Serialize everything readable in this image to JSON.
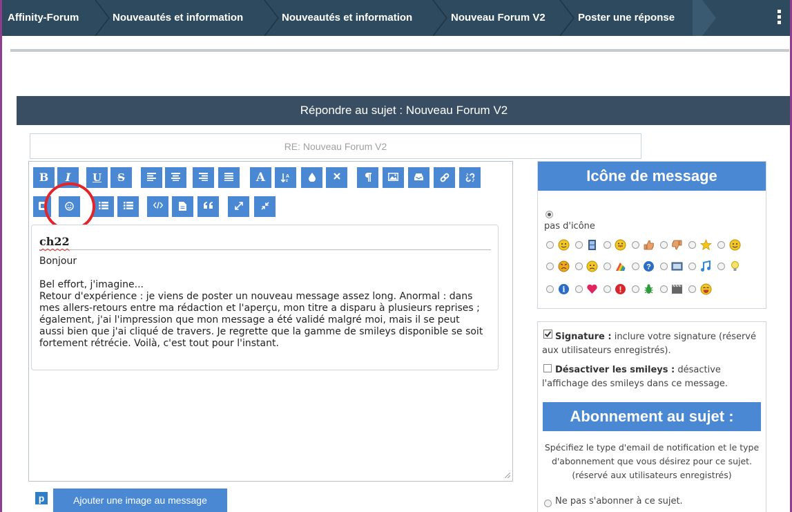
{
  "breadcrumb": {
    "items": [
      "Affinity-Forum",
      "Nouveautés et information",
      "Nouveautés et information",
      "Nouveau Forum V2",
      "Poster une réponse"
    ]
  },
  "form": {
    "heading": "Répondre au sujet : Nouveau Forum V2",
    "title_value": "RE: Nouveau Forum V2"
  },
  "toolbar": {
    "row1": [
      {
        "name": "bold-button",
        "icon": "B"
      },
      {
        "name": "italic-button",
        "icon": "I"
      },
      {
        "name": "underline-button",
        "icon": "U"
      },
      {
        "name": "strikethrough-button",
        "icon": "S"
      },
      {
        "name": "align-left-button",
        "icon": "align-left-icon"
      },
      {
        "name": "align-center-button",
        "icon": "align-center-icon"
      },
      {
        "name": "align-right-button",
        "icon": "align-right-icon"
      },
      {
        "name": "justify-button",
        "icon": "justify-icon"
      },
      {
        "name": "font-button",
        "icon": "A"
      },
      {
        "name": "font-size-button",
        "icon": "font-size-icon"
      },
      {
        "name": "color-button",
        "icon": "droplet-icon"
      },
      {
        "name": "remove-format-button",
        "icon": "close-icon"
      },
      {
        "name": "paragraph-button",
        "icon": "pilcrow-icon"
      },
      {
        "name": "image-button",
        "icon": "image-icon"
      },
      {
        "name": "hosted-image-button",
        "icon": "inbox-icon"
      },
      {
        "name": "link-button",
        "icon": "link-icon"
      },
      {
        "name": "unlink-button",
        "icon": "unlink-icon"
      }
    ],
    "row2": [
      {
        "name": "embed-button",
        "icon": "media-icon"
      },
      {
        "name": "emoticon-button",
        "icon": "smiley-icon"
      },
      {
        "name": "bullet-list-button",
        "icon": "list-icon"
      },
      {
        "name": "numbered-list-button",
        "icon": "list-ordered-icon"
      },
      {
        "name": "code-button",
        "icon": "code-icon"
      },
      {
        "name": "document-button",
        "icon": "document-icon"
      },
      {
        "name": "quote-button",
        "icon": "quote-icon"
      },
      {
        "name": "expand-button",
        "icon": "expand-icon"
      },
      {
        "name": "collapse-button",
        "icon": "collapse-icon"
      }
    ]
  },
  "message": {
    "signature_name": "ch22",
    "lines": [
      "Bonjour",
      "",
      "Bel effort, j'imagine...",
      "Retour d'expérience : je viens de poster un nouveau message assez long. Anormal : dans",
      "mes allers-retours entre ma rédaction et l'aperçu, mon titre a disparu à plusieurs reprises ;",
      "également, j'ai l'impression que mon message a été validé malgré moi, mais il se peut",
      "aussi bien que j'ai cliqué de travers. Je regrette que la gamme de smileys disponible se soit",
      "fortement rétrécie. Voilà, c'est tout pour l'instant."
    ]
  },
  "add_image": {
    "icon_letter": "p",
    "label": "Ajouter une image au message"
  },
  "message_icon": {
    "heading": "Icône de message",
    "none_label": "pas d'icône",
    "icons": [
      "smile-icon",
      "film-icon",
      "tongue-icon",
      "thumbs-up-icon",
      "thumbs-down-icon",
      "star-icon",
      "happy-icon",
      "angry-icon",
      "sad-icon",
      "rainbow-icon",
      "question-icon",
      "screen-icon",
      "music-icon",
      "bulb-icon",
      "info-icon",
      "heart-icon",
      "exclamation-icon",
      "bug-icon",
      "clapper-icon",
      "laugh-icon"
    ]
  },
  "options": {
    "signature_label": "Signature :",
    "signature_desc": "inclure votre signature (réservé aux utilisateurs enregistrés).",
    "smileys_label": "Désactiver les smileys :",
    "smileys_desc": "désactive l'affichage des smileys dans ce message.",
    "subscribe_heading": "Abonnement au sujet :",
    "subscribe_desc": "Spécifiez le type d'email de notification et le type d'abonnement que vous désirez pour ce sujet. (réservé aux utilisateurs enregistrés)",
    "no_subscribe_label": "Ne pas s'abonner à ce sujet."
  },
  "colors": {
    "topbar": "#2e4a5e",
    "header": "#3a4e63",
    "button": "#4a88d4",
    "highlight": "#e0262b"
  }
}
